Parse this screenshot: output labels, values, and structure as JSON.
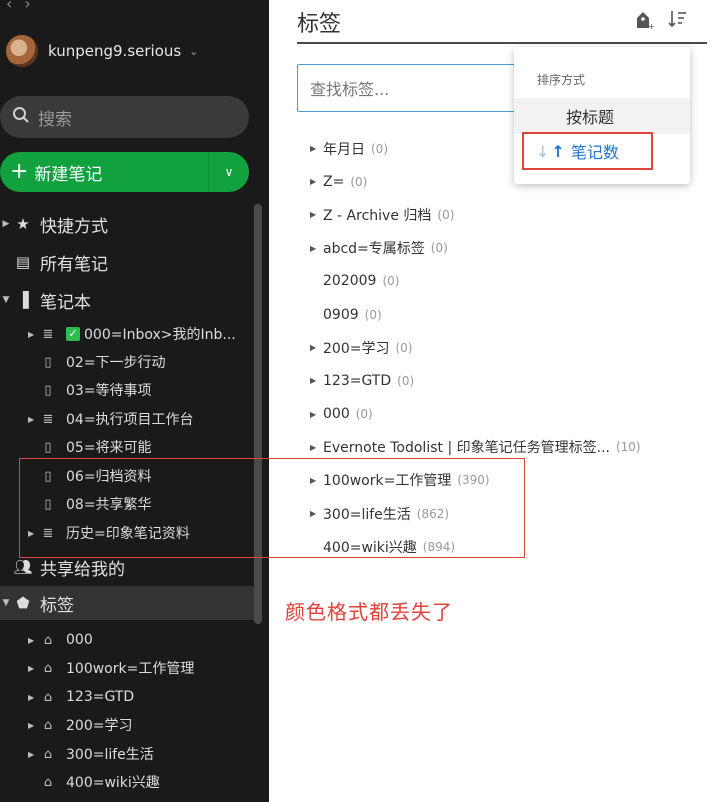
{
  "sidebar": {
    "user": {
      "name": "kunpeng9.serious"
    },
    "search_placeholder": "搜索",
    "new_note_label": "新建笔记",
    "nav": {
      "shortcuts": "快捷方式",
      "all_notes": "所有笔记",
      "notebooks": "笔记本",
      "shared": "共享给我的",
      "tags": "标签"
    },
    "notebooks": [
      {
        "label": "000=Inbox>我的Inb...",
        "stack": true,
        "checked": true
      },
      {
        "label": "02=下一步行动",
        "stack": false
      },
      {
        "label": "03=等待事项",
        "stack": false
      },
      {
        "label": "04=执行项目工作台",
        "stack": true
      },
      {
        "label": "05=将来可能",
        "stack": false
      },
      {
        "label": "06=归档资料",
        "stack": false
      },
      {
        "label": "08=共享繁华",
        "stack": false
      },
      {
        "label": "历史=印象笔记资料",
        "stack": true
      }
    ],
    "tags": [
      {
        "label": "000"
      },
      {
        "label": "100work=工作管理"
      },
      {
        "label": "123=GTD"
      },
      {
        "label": "200=学习"
      },
      {
        "label": "300=life生活"
      },
      {
        "label": "400=wiki兴趣"
      }
    ]
  },
  "main": {
    "title": "标签",
    "find_placeholder": "查找标签...",
    "annotation_text": "颜色格式都丢失了",
    "tag_list": [
      {
        "label": "年月日",
        "count": "(0)",
        "expandable": true
      },
      {
        "label": "Z=",
        "count": "(0)",
        "expandable": true
      },
      {
        "label": "Z - Archive 归档",
        "count": "(0)",
        "expandable": true
      },
      {
        "label": "abcd=专属标签",
        "count": "(0)",
        "expandable": true
      },
      {
        "label": "202009",
        "count": "(0)",
        "expandable": false
      },
      {
        "label": "0909",
        "count": "(0)",
        "expandable": false
      },
      {
        "label": "200=学习",
        "count": "(0)",
        "expandable": true
      },
      {
        "label": "123=GTD",
        "count": "(0)",
        "expandable": true
      },
      {
        "label": "000",
        "count": "(0)",
        "expandable": true
      },
      {
        "label": "Evernote Todolist | 印象笔记任务管理标签...",
        "count": "(10)",
        "expandable": true
      },
      {
        "label": "100work=工作管理",
        "count": "(390)",
        "expandable": true
      },
      {
        "label": "300=life生活",
        "count": "(862)",
        "expandable": true
      },
      {
        "label": "400=wiki兴趣",
        "count": "(894)",
        "expandable": false
      }
    ],
    "sort_menu": {
      "header": "排序方式",
      "options": [
        "按标题",
        "笔记数"
      ]
    }
  },
  "colors": {
    "sidebar_bg": "#1a1a1a",
    "accent_green": "#11a13f",
    "annotation_red": "#e0433a",
    "link_blue": "#2375c9"
  }
}
